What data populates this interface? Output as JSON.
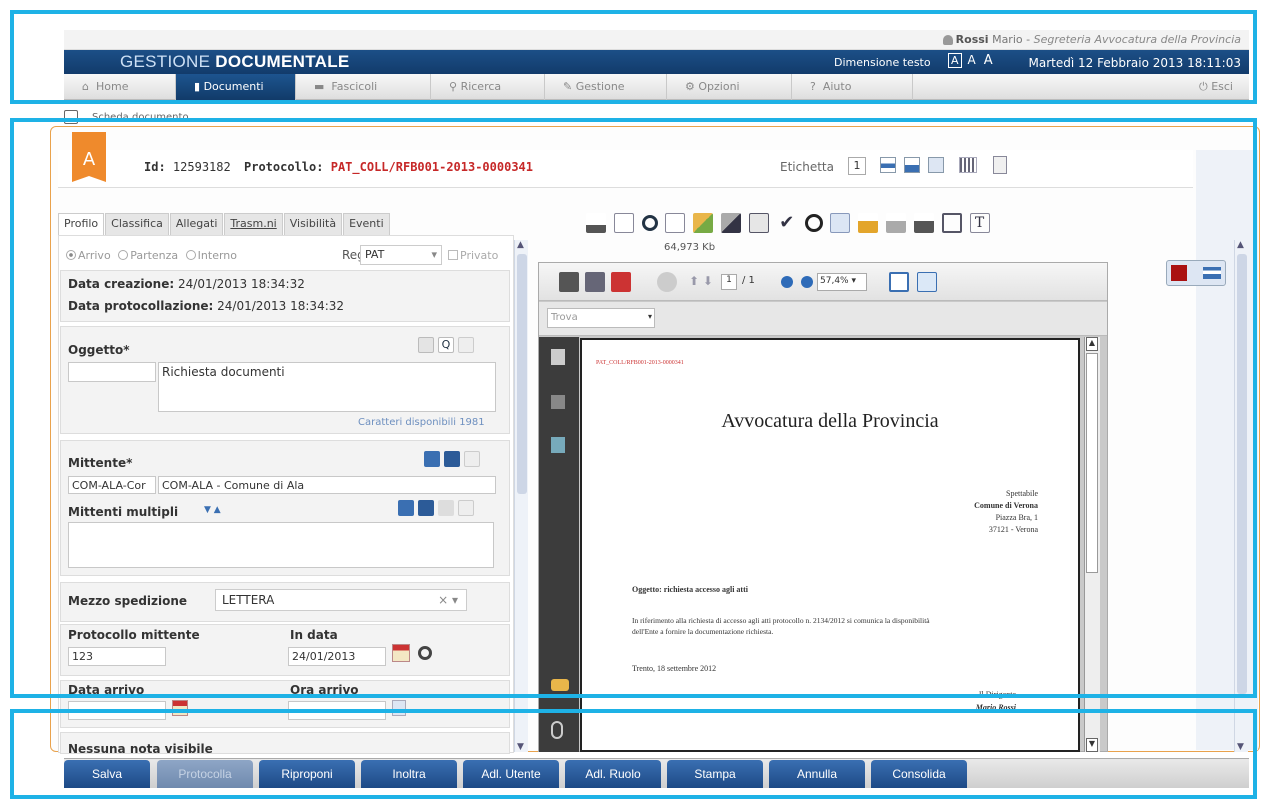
{
  "header": {
    "user_name": "Rossi",
    "user_rest": "Mario - ",
    "user_office": "Segreteria Avvocatura della Provincia",
    "app_title_light": "GESTIONE ",
    "app_title_bold": "DOCUMENTALE",
    "dimensione_testo_label": "Dimensione testo",
    "text_sizes": [
      "A",
      "A",
      "A"
    ],
    "datetime": "Martedì 12 Febbraio 2013 18:11:03"
  },
  "menu": {
    "items": [
      {
        "label": "Home",
        "icon": "home-icon"
      },
      {
        "label": "Documenti",
        "icon": "document-icon"
      },
      {
        "label": "Fascicoli",
        "icon": "folder-icon"
      },
      {
        "label": "Ricerca",
        "icon": "search-icon"
      },
      {
        "label": "Gestione",
        "icon": "pencil-icon"
      },
      {
        "label": "Opzioni",
        "icon": "options-icon"
      },
      {
        "label": "Aiuto",
        "icon": "help-icon"
      }
    ],
    "exit_label": "Esci",
    "help_glyph": "?"
  },
  "breadcrumb": {
    "label": "Scheda documento"
  },
  "document": {
    "badge_letter": "A",
    "id_label": "Id:",
    "id_value": "12593182",
    "protocollo_label": "Protocollo:",
    "protocollo_value": "PAT_COLL/RFB001-2013-0000341",
    "etichetta_label": "Etichetta",
    "etichetta_value": "1"
  },
  "tabs": [
    {
      "label": "Profilo",
      "active": true
    },
    {
      "label": "Classifica"
    },
    {
      "label": "Allegati"
    },
    {
      "label": "Trasm.ni"
    },
    {
      "label": "Visibilità"
    },
    {
      "label": "Eventi"
    }
  ],
  "profilo": {
    "radio_arrivo": "Arrivo",
    "radio_partenza": "Partenza",
    "radio_interno": "Interno",
    "reg_label": "Reg",
    "reg_value": "PAT",
    "privato_label": "Privato",
    "data_creazione_label": "Data creazione:",
    "data_creazione_value": "24/01/2013 18:34:32",
    "data_protocollazione_label": "Data protocollazione:",
    "data_protocollazione_value": "24/01/2013 18:34:32",
    "oggetto_label": "Oggetto*",
    "oggetto_value": "Richiesta documenti",
    "caratteri_label": "Caratteri disponibili 1981",
    "mittente_label": "Mittente*",
    "mittente_code": "COM-ALA-Cor",
    "mittente_value": "COM-ALA - Comune di Ala",
    "mittenti_multipli_label": "Mittenti multipli",
    "mezzo_spedizione_label": "Mezzo spedizione",
    "mezzo_spedizione_value": "LETTERA",
    "protocollo_mittente_label": "Protocollo mittente",
    "protocollo_mittente_value": "123",
    "in_data_label": "In data",
    "in_data_value": "24/01/2013",
    "data_arrivo_label": "Data arrivo",
    "ora_arrivo_label": "Ora arrivo",
    "nessuna_nota_label": "Nessuna nota visibile"
  },
  "viewer": {
    "file_size": "64,973 Kb",
    "page_current": "1",
    "page_total": "/ 1",
    "zoom": "57,4%",
    "find_placeholder": "Trova"
  },
  "pdf": {
    "header_code": "PAT_COLL/RFB001-2013-0000341",
    "title": "Avvocatura della Provincia",
    "addr": [
      "Spettabile",
      "Comune di Verona",
      "Piazza Bra, 1",
      "37121 - Verona"
    ],
    "oggetto": "Oggetto: richiesta accesso agli atti",
    "body1": "In riferimento alla richiesta di accesso agli atti protocollo n. 2134/2012 si comunica la disponibilità",
    "body2": "dell'Ente a fornire la documentazione richiesta.",
    "date_line": "Trento, 18 settembre 2012",
    "sign_role": "Il Dirigente",
    "sign_name": "Mario Rossi"
  },
  "buttons": [
    {
      "label": "Salva"
    },
    {
      "label": "Protocolla",
      "disabled": true
    },
    {
      "label": "Riproponi"
    },
    {
      "label": "Inoltra"
    },
    {
      "label": "Adl. Utente"
    },
    {
      "label": "Adl. Ruolo"
    },
    {
      "label": "Stampa"
    },
    {
      "label": "Annulla"
    },
    {
      "label": "Consolida"
    }
  ],
  "colors": {
    "accent": "#1d4f88",
    "highlight_frame": "#1eb2e6",
    "protocol_red": "#c62828",
    "badge_orange": "#ef8a2c"
  }
}
